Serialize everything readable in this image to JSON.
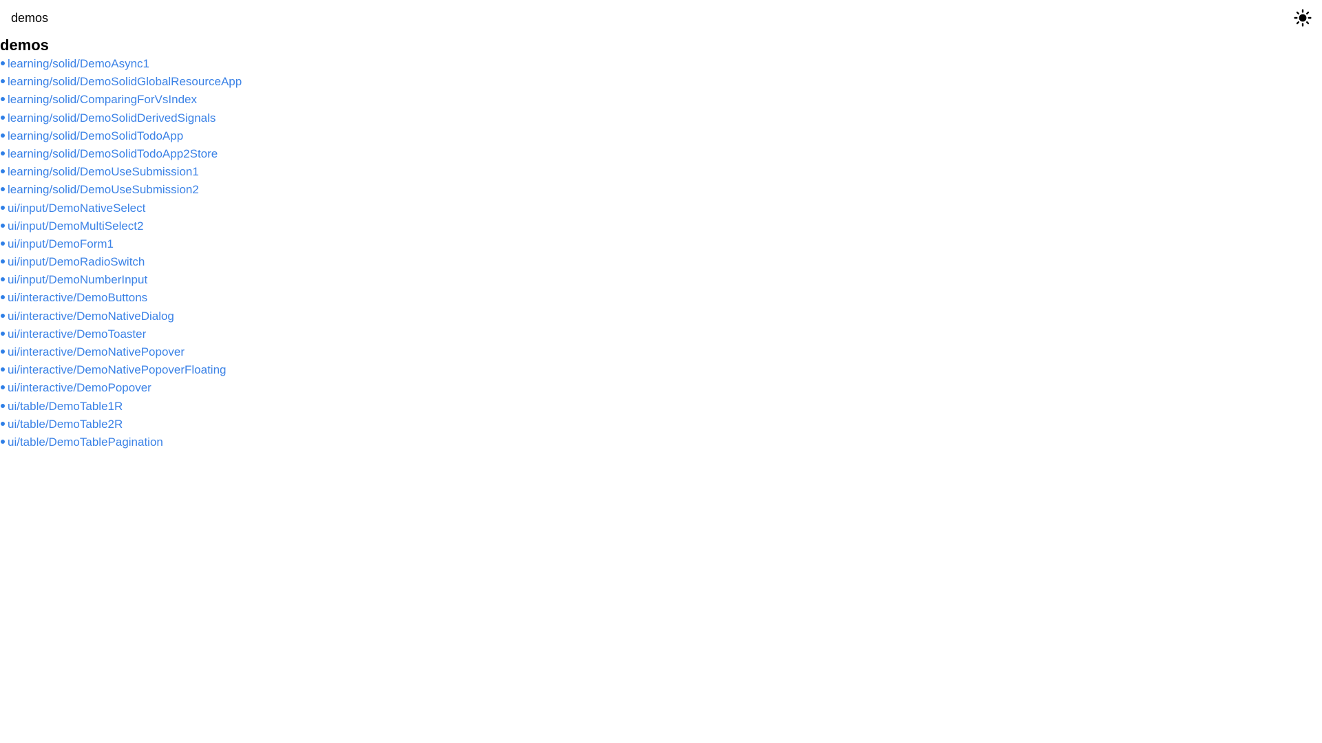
{
  "header": {
    "brand": "demos",
    "theme_toggle_icon": "sun-icon"
  },
  "main": {
    "title": "demos",
    "links": [
      "learning/solid/DemoAsync1",
      "learning/solid/DemoSolidGlobalResourceApp",
      "learning/solid/ComparingForVsIndex",
      "learning/solid/DemoSolidDerivedSignals",
      "learning/solid/DemoSolidTodoApp",
      "learning/solid/DemoSolidTodoApp2Store",
      "learning/solid/DemoUseSubmission1",
      "learning/solid/DemoUseSubmission2",
      "ui/input/DemoNativeSelect",
      "ui/input/DemoMultiSelect2",
      "ui/input/DemoForm1",
      "ui/input/DemoRadioSwitch",
      "ui/input/DemoNumberInput",
      "ui/interactive/DemoButtons",
      "ui/interactive/DemoNativeDialog",
      "ui/interactive/DemoToaster",
      "ui/interactive/DemoNativePopover",
      "ui/interactive/DemoNativePopoverFloating",
      "ui/interactive/DemoPopover",
      "ui/table/DemoTable1R",
      "ui/table/DemoTable2R",
      "ui/table/DemoTablePagination"
    ]
  },
  "colors": {
    "link": "#3b82e6",
    "bullet": "#2f7fe6",
    "text": "#000000",
    "background": "#ffffff"
  }
}
